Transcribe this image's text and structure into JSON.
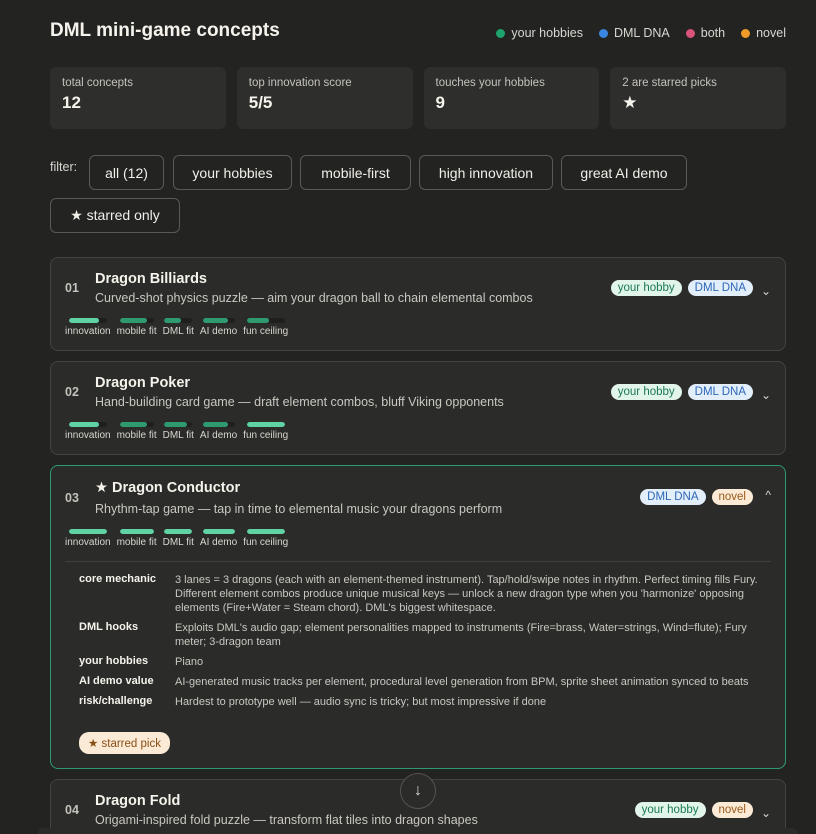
{
  "header": {
    "title": "DML mini-game concepts",
    "legend": [
      {
        "label": "your hobbies",
        "color": "#1fa36e"
      },
      {
        "label": "DML DNA",
        "color": "#3b86e0"
      },
      {
        "label": "both",
        "color": "#d9537a"
      },
      {
        "label": "novel",
        "color": "#f09a2a"
      }
    ]
  },
  "stats": [
    {
      "label": "total concepts",
      "value": "12"
    },
    {
      "label": "top innovation score",
      "value": "5/5"
    },
    {
      "label": "touches your hobbies",
      "value": "9"
    },
    {
      "label": "2 are starred picks",
      "value": "★"
    }
  ],
  "filters": {
    "label": "filter:",
    "buttons": [
      "all (12)",
      "your hobbies",
      "mobile-first",
      "high innovation",
      "great AI demo",
      "★ starred only"
    ]
  },
  "bar_labels": [
    "innovation",
    "mobile fit",
    "DML fit",
    "AI demo",
    "fun ceiling"
  ],
  "bar_colors": {
    "high": "#2f9a70",
    "top": "#5fd3a3"
  },
  "cards": [
    {
      "num": "01",
      "name": "Dragon Billiards",
      "desc": "Curved-shot physics puzzle — aim your dragon ball to chain elemental combos",
      "tags": [
        {
          "label": "your hobby",
          "kind": "hobby"
        },
        {
          "label": "DML DNA",
          "kind": "dna"
        }
      ],
      "chevron": "⌄",
      "scores": [
        4,
        4,
        3,
        4,
        3
      ]
    },
    {
      "num": "02",
      "name": "Dragon Poker",
      "desc": "Hand-building card game — draft element combos, bluff Viking opponents",
      "tags": [
        {
          "label": "your hobby",
          "kind": "hobby"
        },
        {
          "label": "DML DNA",
          "kind": "dna"
        }
      ],
      "chevron": "⌄",
      "scores": [
        4,
        4,
        4,
        4,
        5
      ]
    },
    {
      "num": "03",
      "star": "★",
      "name": "Dragon Conductor",
      "desc": "Rhythm-tap game — tap in time to elemental music your dragons perform",
      "tags": [
        {
          "label": "DML DNA",
          "kind": "dna"
        },
        {
          "label": "novel",
          "kind": "novel"
        }
      ],
      "chevron": "^",
      "scores": [
        5,
        5,
        5,
        5,
        5
      ],
      "details": [
        {
          "key": "core mechanic",
          "value": "3 lanes = 3 dragons (each with an element-themed instrument). Tap/hold/swipe notes in rhythm. Perfect timing fills Fury. Different element combos produce unique musical keys — unlock a new dragon type when you 'harmonize' opposing elements (Fire+Water = Steam chord). DML's biggest whitespace."
        },
        {
          "key": "DML hooks",
          "value": "Exploits DML's audio gap; element personalities mapped to instruments (Fire=brass, Water=strings, Wind=flute); Fury meter; 3-dragon team"
        },
        {
          "key": "your hobbies",
          "value": "Piano"
        },
        {
          "key": "AI demo value",
          "value": "AI-generated music tracks per element, procedural level generation from BPM, sprite sheet animation synced to beats"
        },
        {
          "key": "risk/challenge",
          "value": "Hardest to prototype well — audio sync is tricky; but most impressive if done"
        }
      ],
      "badge": "★ starred pick"
    },
    {
      "num": "04",
      "name": "Dragon Fold",
      "desc": "Origami-inspired fold puzzle — transform flat tiles into dragon shapes",
      "tags": [
        {
          "label": "your hobby",
          "kind": "hobby"
        },
        {
          "label": "novel",
          "kind": "novel"
        }
      ],
      "chevron": "⌄"
    }
  ],
  "scroll_icon": "↓"
}
